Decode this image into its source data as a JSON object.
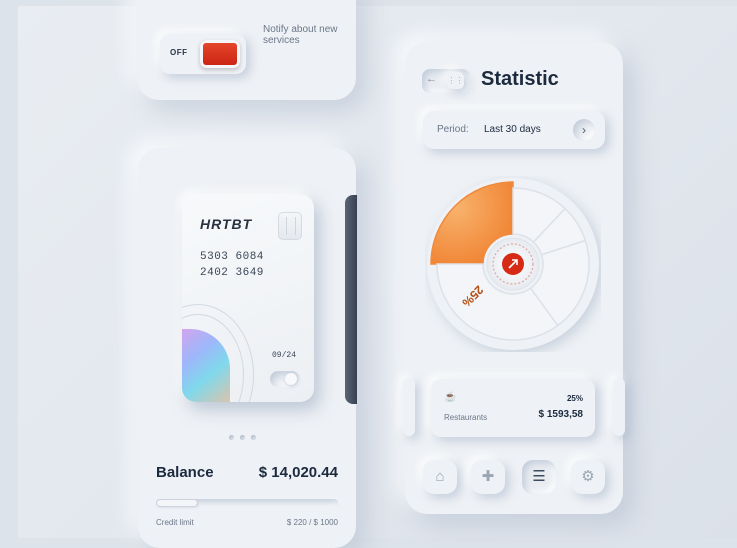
{
  "notify": {
    "toggle_state_label": "OFF",
    "label": "Notify about new services",
    "accent_color": "#d72a15"
  },
  "card": {
    "brand": "HRTBT",
    "number_line1": "5303 6084",
    "number_line2": "2402 3649",
    "expiry": "09/24",
    "carousel_pages": 3,
    "carousel_active": 0
  },
  "balance": {
    "label": "Balance",
    "value": "$ 14,020.44",
    "credit_label": "Credit limit",
    "credit_value": "$ 220 / $ 1000",
    "credit_fraction": 0.22
  },
  "statistic": {
    "title": "Statistic",
    "period_label": "Period:",
    "period_value": "Last 30 days",
    "pie_highlight_label": "25%",
    "pie_highlight_color": "#f08a3c",
    "center_button_color": "#d72a15",
    "expense": {
      "icon": "coffee-cup-icon",
      "name": "Restaurants",
      "percent": "25%",
      "amount": "$ 1593,58"
    },
    "nav_icons": [
      "home-icon",
      "move-icon",
      "stack-icon",
      "gear-icon"
    ],
    "nav_active_index": 2
  },
  "chart_data": {
    "type": "pie",
    "slices": [
      {
        "label": "25%",
        "value": 25,
        "highlighted": true
      },
      {
        "label": "",
        "value": 12
      },
      {
        "label": "",
        "value": 8
      },
      {
        "label": "",
        "value": 20
      },
      {
        "label": "",
        "value": 35
      }
    ],
    "title": ""
  }
}
